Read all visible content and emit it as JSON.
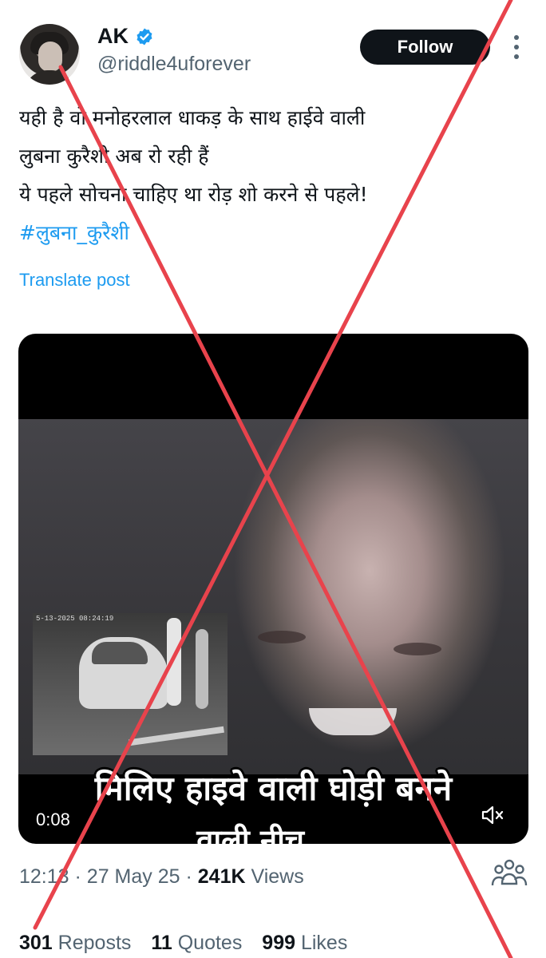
{
  "author": {
    "name": "AK",
    "handle": "@riddle4uforever",
    "verified": true,
    "avatar_icon": "user-avatar-photo"
  },
  "follow_label": "Follow",
  "tweet": {
    "lines": [
      "यही है वो मनोहरलाल धाकड़ के साथ हाईवे वाली",
      "लुबना कुरैशी अब रो रही हैं",
      "ये पहले सोचना चाहिए था रोड़ शो करने से पहले!"
    ],
    "hashtag": "#लुबना_कुरैशी",
    "translate_label": "Translate post"
  },
  "media": {
    "caption_line1": "मिलिए हाइवे वाली घोड़ी बनने",
    "caption_line2": "वाली नीच....",
    "duration": "0:08",
    "inset_timestamp": "5-13-2025 08:24:19",
    "mute_icon": "volume-muted-icon"
  },
  "meta": {
    "time": "12:13",
    "date": "27 May 25",
    "views_count": "241K",
    "views_label": "Views",
    "separator": "·"
  },
  "stats": {
    "reposts_count": "301",
    "reposts_label": "Reposts",
    "quotes_count": "11",
    "quotes_label": "Quotes",
    "likes_count": "999",
    "likes_label": "Likes"
  },
  "colors": {
    "accent": "#1d9bf0",
    "text": "#0f1419",
    "muted": "#536471",
    "cross_mark": "#e8434c"
  }
}
